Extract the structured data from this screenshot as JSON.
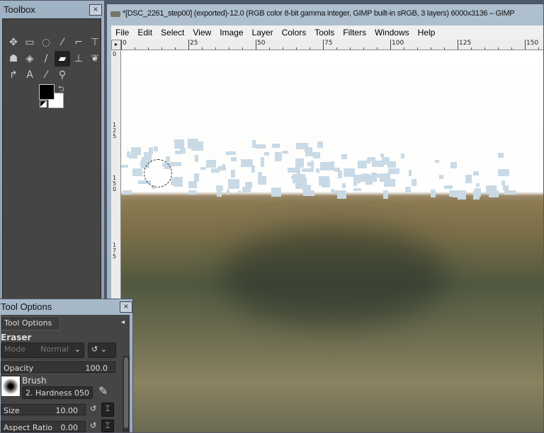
{
  "toolbox": {
    "title": "Toolbox",
    "close": "×",
    "tools": [
      {
        "name": "move-tool",
        "glyph": "✥"
      },
      {
        "name": "rect-select-tool",
        "glyph": "▭"
      },
      {
        "name": "lasso-tool",
        "glyph": "◌"
      },
      {
        "name": "fuzzy-select-tool",
        "glyph": "⁄"
      },
      {
        "name": "crop-tool",
        "glyph": "⌐"
      },
      {
        "name": "transform-tool",
        "glyph": "⊤"
      },
      {
        "name": "warp-tool",
        "glyph": "☗"
      },
      {
        "name": "bucket-fill-tool",
        "glyph": "◈"
      },
      {
        "name": "paintbrush-tool",
        "glyph": "∕"
      },
      {
        "name": "eraser-tool",
        "glyph": "▰",
        "active": true
      },
      {
        "name": "clone-tool",
        "glyph": "⊥"
      },
      {
        "name": "smudge-tool",
        "glyph": "❦"
      },
      {
        "name": "path-tool",
        "glyph": "↱"
      },
      {
        "name": "text-tool",
        "glyph": "A"
      },
      {
        "name": "color-picker-tool",
        "glyph": "⁄"
      },
      {
        "name": "zoom-tool",
        "glyph": "⚲"
      }
    ],
    "fg_color": "#000000",
    "bg_color": "#ffffff"
  },
  "image_window": {
    "title": "*[DSC_2261_step00] (exported)-12.0 (RGB color 8-bit gamma integer, GIMP built-in sRGB, 3 layers) 6000x3136 – GIMP",
    "menu": [
      "File",
      "Edit",
      "Select",
      "View",
      "Image",
      "Layer",
      "Colors",
      "Tools",
      "Filters",
      "Windows",
      "Help"
    ],
    "hruler": [
      "0",
      "25",
      "50",
      "75",
      "100",
      "125",
      "150"
    ],
    "vruler": [
      "0",
      "125",
      "150",
      "175"
    ]
  },
  "tool_options": {
    "title": "Tool Options",
    "close": "×",
    "tab": "Tool Options",
    "tool": "Eraser",
    "mode_label": "Mode",
    "mode_value": "Normal",
    "opacity_label": "Opacity",
    "opacity_value": "100.0",
    "brush_label": "Brush",
    "brush_value": "2. Hardness 050",
    "size_label": "Size",
    "size_value": "10.00",
    "aspect_label": "Aspect Ratio",
    "aspect_value": "0.00"
  }
}
